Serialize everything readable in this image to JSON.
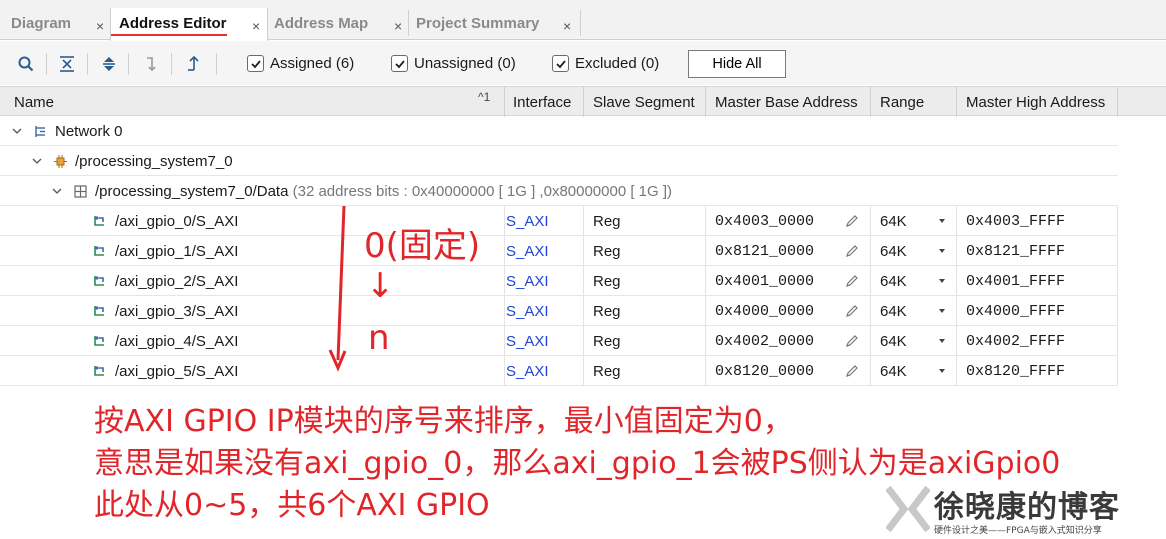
{
  "tabs": [
    {
      "label": "Diagram",
      "active": false
    },
    {
      "label": "Address Editor",
      "active": true
    },
    {
      "label": "Address Map",
      "active": false
    },
    {
      "label": "Project Summary",
      "active": false
    }
  ],
  "tab_close": "×",
  "toolbar": {
    "icons": [
      "search-icon",
      "collapse-all-icon",
      "expand-all-icon",
      "auto-assign-icon",
      "move-up-icon"
    ],
    "filters": [
      {
        "label": "Assigned (6)",
        "checked": true
      },
      {
        "label": "Unassigned (0)",
        "checked": true
      },
      {
        "label": "Excluded (0)",
        "checked": true
      }
    ],
    "hide_all": "Hide All"
  },
  "columns": {
    "name": "Name",
    "sort": "^1",
    "interface": "Interface",
    "slave_segment": "Slave Segment",
    "master_base_address": "Master Base Address",
    "range": "Range",
    "master_high_address": "Master High Address"
  },
  "tree": {
    "network": "Network 0",
    "processor": "/processing_system7_0",
    "data_path": "/processing_system7_0/Data",
    "data_detail": "(32 address bits : 0x40000000 [ 1G ] ,0x80000000 [ 1G ])"
  },
  "rows": [
    {
      "name": "/axi_gpio_0/S_AXI",
      "interface": "S_AXI",
      "segment": "Reg",
      "base": "0x4003_0000",
      "range": "64K",
      "high": "0x4003_FFFF"
    },
    {
      "name": "/axi_gpio_1/S_AXI",
      "interface": "S_AXI",
      "segment": "Reg",
      "base": "0x8121_0000",
      "range": "64K",
      "high": "0x8121_FFFF"
    },
    {
      "name": "/axi_gpio_2/S_AXI",
      "interface": "S_AXI",
      "segment": "Reg",
      "base": "0x4001_0000",
      "range": "64K",
      "high": "0x4001_FFFF"
    },
    {
      "name": "/axi_gpio_3/S_AXI",
      "interface": "S_AXI",
      "segment": "Reg",
      "base": "0x4000_0000",
      "range": "64K",
      "high": "0x4000_FFFF"
    },
    {
      "name": "/axi_gpio_4/S_AXI",
      "interface": "S_AXI",
      "segment": "Reg",
      "base": "0x4002_0000",
      "range": "64K",
      "high": "0x4002_FFFF"
    },
    {
      "name": "/axi_gpio_5/S_AXI",
      "interface": "S_AXI",
      "segment": "Reg",
      "base": "0x8120_0000",
      "range": "64K",
      "high": "0x8120_FFFF"
    }
  ],
  "annotation": {
    "start": "0(固定)",
    "arrow": "↓",
    "end": "n",
    "line1": "按AXI GPIO IP模块的序号来排序，最小值固定为0，",
    "line2": "意思是如果没有axi_gpio_0，那么axi_gpio_1会被PS侧认为是axiGpio0",
    "line3": "此处从0~5，共6个AXI GPIO"
  },
  "watermark": {
    "title": "徐晓康的博客",
    "subtitle": "硬件设计之美——FPGA与嵌入式知识分享"
  },
  "colors": {
    "annotation": "#e0262a",
    "link": "#1f46d6",
    "active_tab_underline": "#d33333"
  }
}
